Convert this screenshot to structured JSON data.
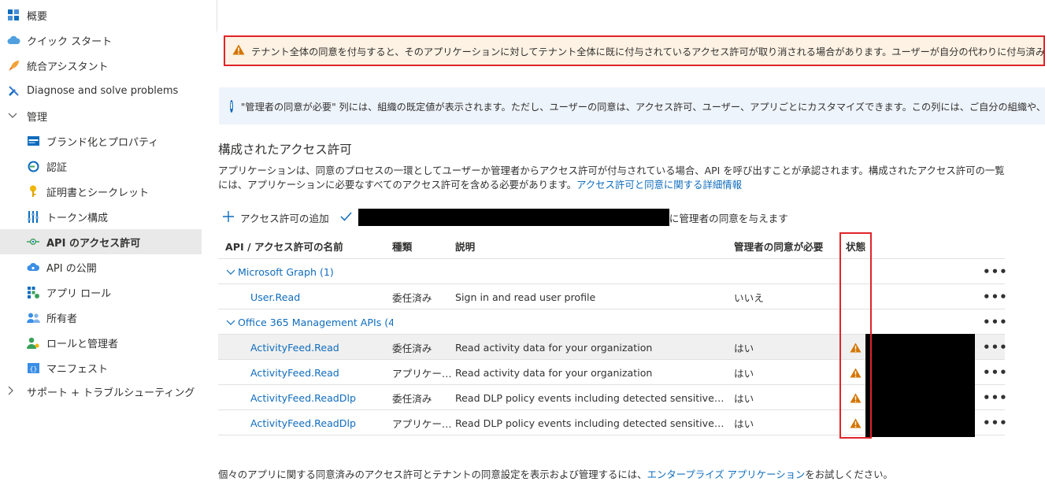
{
  "sidebar": {
    "items": [
      {
        "label": "概要",
        "icon": "overview-icon"
      },
      {
        "label": "クイック スタート",
        "icon": "quickstart-cloud-icon"
      },
      {
        "label": "統合アシスタント",
        "icon": "rocket-icon"
      },
      {
        "label": "Diagnose and solve problems",
        "icon": "wrench-icon"
      },
      {
        "label": "管理",
        "icon": "chevron-down-icon"
      },
      {
        "label": "ブランド化とプロパティ",
        "icon": "branding-icon"
      },
      {
        "label": "認証",
        "icon": "authentication-icon"
      },
      {
        "label": "証明書とシークレット",
        "icon": "key-icon"
      },
      {
        "label": "トークン構成",
        "icon": "token-config-icon"
      },
      {
        "label": "API のアクセス許可",
        "icon": "api-permissions-icon"
      },
      {
        "label": "API の公開",
        "icon": "expose-api-cloud-icon"
      },
      {
        "label": "アプリ ロール",
        "icon": "app-roles-icon"
      },
      {
        "label": "所有者",
        "icon": "owners-icon"
      },
      {
        "label": "ロールと管理者",
        "icon": "roles-admins-icon"
      },
      {
        "label": "マニフェスト",
        "icon": "manifest-icon"
      },
      {
        "label": "サポート + トラブルシューティング",
        "icon": "chevron-right-icon"
      }
    ]
  },
  "warning_banner": {
    "text": "テナント全体の同意を付与すると、そのアプリケーションに対してテナント全体に既に付与されているアクセス許可が取り消される場合があります。ユーザーが自分の代わりに付与済みのアクセス許可は影響を受けません。"
  },
  "info_banner": {
    "text": "\"管理者の同意が必要\" 列には、組織の既定値が表示されます。ただし、ユーザーの同意は、アクセス許可、ユーザー、アプリごとにカスタマイズできます。この列には、ご自分の組織や、このアプリが使用される組織の値が反"
  },
  "section": {
    "title": "構成されたアクセス許可",
    "description": "アプリケーションは、同意のプロセスの一環としてユーザーか管理者からアクセス許可が付与されている場合、API を呼び出すことが承認されます。構成されたアクセス許可の一覧には、アプリケーションに必要なすべてのアクセス許可を含める必要があります。",
    "link": "アクセス許可と同意に関する詳細情報"
  },
  "toolbar": {
    "add_label": "アクセス許可の追加",
    "grant_suffix": "に管理者の同意を与えます"
  },
  "table": {
    "headers": {
      "name": "API / アクセス許可の名前",
      "type": "種類",
      "description": "説明",
      "admin": "管理者の同意が必要",
      "status": "状態"
    },
    "groups": [
      {
        "name": "Microsoft Graph (1)"
      },
      {
        "name": "Office 365 Management APIs (4"
      }
    ],
    "rows": [
      {
        "name": "User.Read",
        "type": "委任済み",
        "description": "Sign in and read user profile",
        "admin": "いいえ",
        "warning": false
      },
      {
        "name": "ActivityFeed.Read",
        "type": "委任済み",
        "description": "Read activity data for your organization",
        "admin": "はい",
        "warning": true
      },
      {
        "name": "ActivityFeed.Read",
        "type": "アプリケー…",
        "description": "Read activity data for your organization",
        "admin": "はい",
        "warning": true
      },
      {
        "name": "ActivityFeed.ReadDlp",
        "type": "委任済み",
        "description": "Read DLP policy events including detected sensitive…",
        "admin": "はい",
        "warning": true
      },
      {
        "name": "ActivityFeed.ReadDlp",
        "type": "アプリケー…",
        "description": "Read DLP policy events including detected sensitive…",
        "admin": "はい",
        "warning": true
      }
    ],
    "more": "•••"
  },
  "footer": {
    "prefix": "個々のアプリに関する同意済みのアクセス許可とテナントの同意設定を表示および管理するには、",
    "link": "エンタープライズ アプリケーション",
    "suffix": "をお試しください。"
  },
  "colors": {
    "accent": "#0f6cbd",
    "warning": "#d47500",
    "highlight_border": "#e0242a"
  }
}
